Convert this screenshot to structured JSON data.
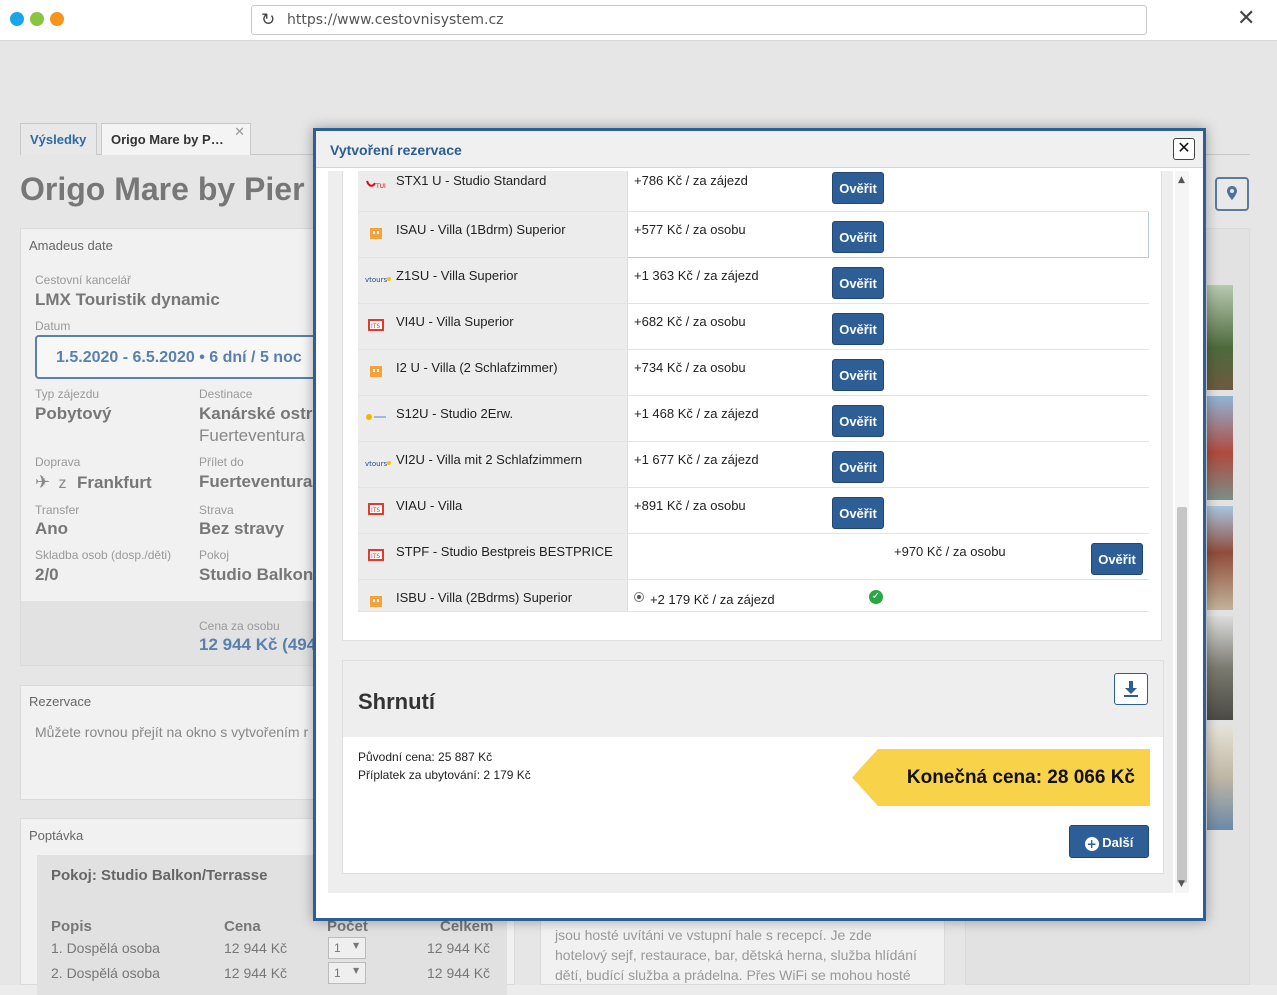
{
  "browser": {
    "url": "https://www.cestovnisystem.cz",
    "dots": [
      "#1aa5e4",
      "#8bc53f",
      "#f7941d"
    ]
  },
  "page": {
    "tabs": [
      "Výsledky",
      "Origo Mare by P…"
    ],
    "title": "Origo Mare by Pier",
    "amadeus": {
      "header": "Amadeus date",
      "agency_label": "Cestovní kancelář",
      "agency": "LMX Touristik dynamic",
      "date_label": "Datum",
      "date": "1.5.2020 - 6.5.2020 • 6 dní / 5 noc",
      "type_label": "Typ zájezdu",
      "type": "Pobytový",
      "dest_label": "Destinace",
      "dest1": "Kanárské ostr",
      "dest2": "Fuerteventura",
      "transport_label": "Doprava",
      "transport_prefix": "z",
      "transport": "Frankfurt",
      "arrival_label": "Přílet do",
      "arrival": "Fuerteventura",
      "transfer_label": "Transfer",
      "transfer": "Ano",
      "board_label": "Strava",
      "board": "Bez stravy",
      "persons_label": "Skladba osob (dosp./děti)",
      "persons": "2/0",
      "room_label": "Pokoj",
      "room": "Studio Balkon",
      "price_label": "Cena za osobu",
      "price": "12 944 Kč (494"
    },
    "reservation": {
      "header": "Rezervace",
      "text": "Můžete rovnou přejít na okno s vytvořením r"
    },
    "inquiry": {
      "header": "Poptávka",
      "room": "Pokoj: Studio Balkon/Terrasse",
      "cols": [
        "Popis",
        "Cena",
        "Počet",
        "Celkem"
      ],
      "rows": [
        {
          "desc": "1. Dospělá osoba",
          "price": "12 944 Kč",
          "qty": "1",
          "total": "12 944 Kč"
        },
        {
          "desc": "2. Dospělá osoba",
          "price": "12 944 Kč",
          "qty": "1",
          "total": "12 944 Kč"
        }
      ]
    },
    "description_lines": [
      "jsou hosté uvítáni ve vstupní hale s recepcí. Je zde",
      "hotelový sejf, restaurace, bar, dětská herna, služba hlídání",
      "dětí, budící služba a prádelna. Přes WiFi se mohou hosté"
    ]
  },
  "modal": {
    "title": "Vytvoření rezervace",
    "close": "✕",
    "button_label": "Ověřit",
    "offers": [
      {
        "logo": "tui",
        "name": "STX1 U - Studio Standard",
        "price": "+786 Kč / za zájezd"
      },
      {
        "logo": "orange",
        "name": "ISAU - Villa (1Bdrm) Superior",
        "price": "+577 Kč / za osobu"
      },
      {
        "logo": "vtours",
        "name": "Z1SU - Villa Superior",
        "price": "+1 363 Kč / za zájezd"
      },
      {
        "logo": "its",
        "name": "VI4U - Villa Superior",
        "price": "+682 Kč / za osobu"
      },
      {
        "logo": "orange",
        "name": "I2 U - Villa (2 Schlafzimmer)",
        "price": "+734 Kč / za osobu"
      },
      {
        "logo": "sun",
        "name": "S12U - Studio 2Erw.",
        "price": "+1 468 Kč / za zájezd"
      },
      {
        "logo": "vtours",
        "name": "VI2U - Villa mit 2 Schlafzimmern",
        "price": "+1 677 Kč / za zájezd"
      },
      {
        "logo": "its",
        "name": "VIAU - Villa",
        "price": "+891 Kč / za osobu"
      },
      {
        "logo": "its",
        "name": "STPF - Studio Bestpreis BESTPRICE",
        "price": "+970 Kč / za osobu"
      },
      {
        "logo": "orange",
        "name": "ISBU - Villa (2Bdrms) Superior",
        "price": "+2 179 Kč / za zájezd",
        "selected": true
      }
    ],
    "summary": {
      "title": "Shrnutí",
      "original_price": "Původní cena: 25 887 Kč",
      "surcharge": "Příplatek za ubytování: 2 179 Kč",
      "final_price": "Konečná cena: 28 066 Kč",
      "next_label": "Další"
    }
  },
  "colors": {
    "accent": "#2d5f96",
    "final_price_bg": "#f8d34a",
    "ok_green": "#27a844"
  }
}
